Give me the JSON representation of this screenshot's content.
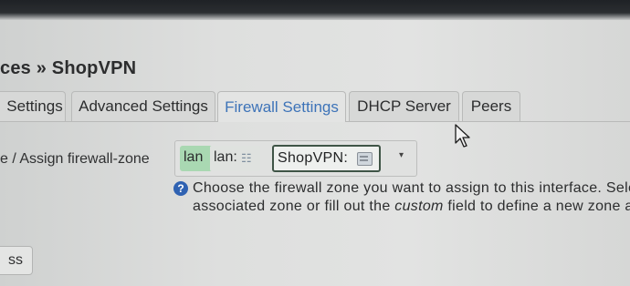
{
  "page": {
    "title": "ces » ShopVPN"
  },
  "tabs": [
    {
      "label": "Settings",
      "active": false
    },
    {
      "label": "Advanced Settings",
      "active": false
    },
    {
      "label": "Firewall Settings",
      "active": true
    },
    {
      "label": "DHCP Server",
      "active": false
    },
    {
      "label": "Peers",
      "active": false
    }
  ],
  "firewall": {
    "field_label": "e / Assign firewall-zone",
    "selected_zones": [
      {
        "zone": "lan",
        "member": "lan:",
        "color": "#a9d8b2"
      },
      {
        "zone": "ShopVPN:",
        "highlighted": true
      }
    ],
    "help": {
      "line1": "Choose the firewall zone you want to assign to this interface. Sele",
      "line2_prefix": "associated zone or fill out the ",
      "line2_em": "custom",
      "line2_suffix": " field to define a new zone a"
    }
  },
  "footer": {
    "button_label": "ss"
  },
  "colors": {
    "accent": "#3d73b8",
    "lan_zone": "#a9d8b2",
    "help_icon": "#2f62b2"
  }
}
